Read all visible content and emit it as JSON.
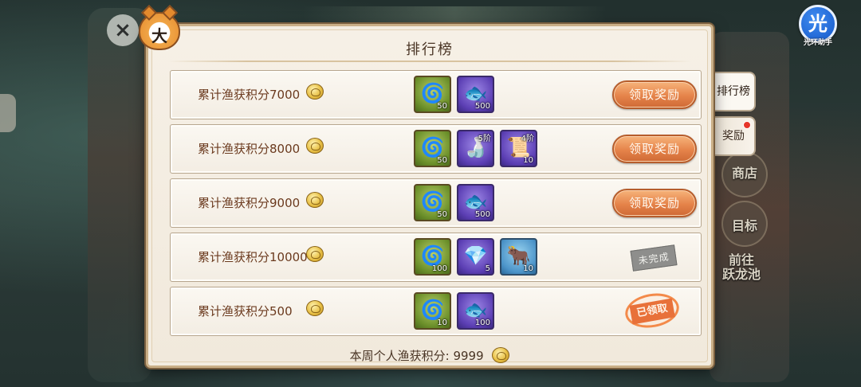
{
  "panel": {
    "title": "排行榜"
  },
  "tabs": [
    {
      "label": "排行榜",
      "active": true
    },
    {
      "label": "奖励",
      "has_notification": true
    }
  ],
  "background_labels": {
    "shop": "商店",
    "goal": "目标",
    "goto_line1": "前往",
    "goto_line2": "跃龙池"
  },
  "helper_app": {
    "glyph": "光",
    "text": "光环助手"
  },
  "rows": [
    {
      "label": "累计渔获积分7000",
      "items": [
        {
          "icon": "green-bead-icon",
          "qty": "50",
          "tier": ""
        },
        {
          "icon": "golden-fish-icon",
          "qty": "500",
          "tier": ""
        }
      ],
      "status": "claimable",
      "button_label": "领取奖励"
    },
    {
      "label": "累计渔获积分8000",
      "items": [
        {
          "icon": "green-bead-icon",
          "qty": "50",
          "tier": ""
        },
        {
          "icon": "bait-bottle-icon",
          "qty": "",
          "tier": "5阶"
        },
        {
          "icon": "scroll-book-icon",
          "qty": "10",
          "tier": "4阶"
        }
      ],
      "status": "claimable",
      "button_label": "领取奖励"
    },
    {
      "label": "累计渔获积分9000",
      "items": [
        {
          "icon": "green-bead-icon",
          "qty": "50",
          "tier": ""
        },
        {
          "icon": "golden-fish-icon",
          "qty": "500",
          "tier": ""
        }
      ],
      "status": "claimable",
      "button_label": "领取奖励"
    },
    {
      "label": "累计渔获积分10000",
      "items": [
        {
          "icon": "green-bead-icon",
          "qty": "100",
          "tier": ""
        },
        {
          "icon": "crystal-shard-icon",
          "qty": "5",
          "tier": ""
        },
        {
          "icon": "ox-pet-icon",
          "qty": "10",
          "tier": ""
        }
      ],
      "status": "incomplete",
      "button_label": "未完成"
    },
    {
      "label": "累计渔获积分500",
      "items": [
        {
          "icon": "green-bead-icon",
          "qty": "10",
          "tier": ""
        },
        {
          "icon": "golden-fish-icon",
          "qty": "100",
          "tier": ""
        }
      ],
      "status": "claimed",
      "button_label": "已领取"
    }
  ],
  "footer": {
    "label": "本周个人渔获积分:",
    "value": "9999"
  },
  "colors": {
    "claim_button": "#e5834a",
    "panel_bg": "#f3ece0",
    "label_text": "#6b3a1e",
    "notification_dot": "#e6362a"
  }
}
